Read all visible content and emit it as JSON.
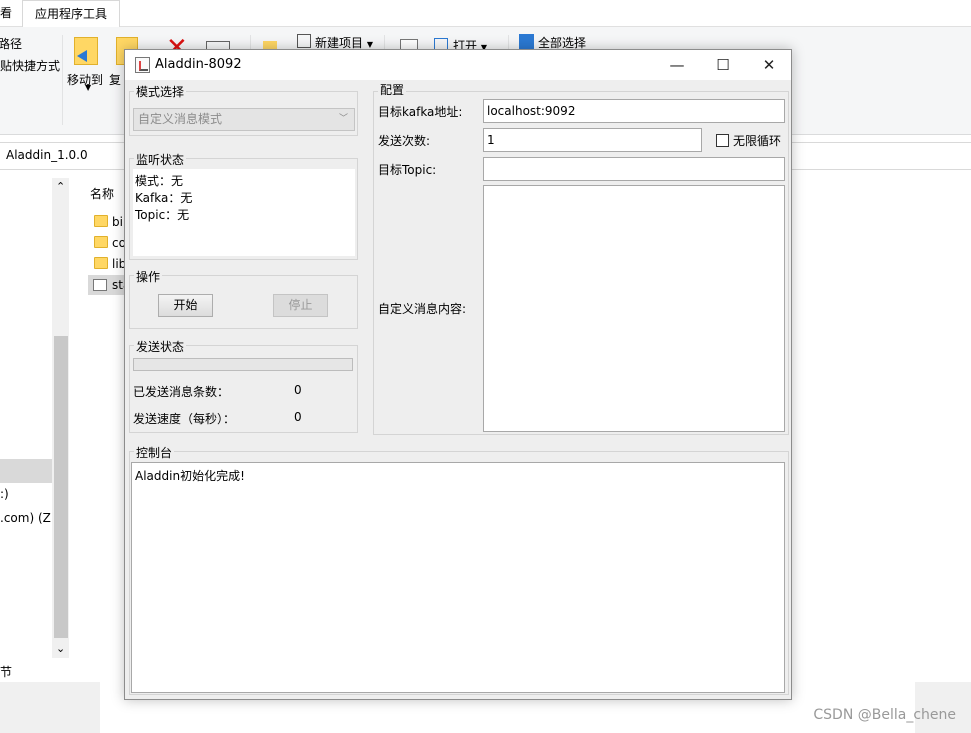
{
  "explorer": {
    "tab_fragment": "看",
    "active_tab": "应用程序工具",
    "ribbon": {
      "path_label": "复制路径",
      "shortcut_label": "粘贴快捷方式",
      "move_to": "移动到",
      "copy_to": "复",
      "new_item": "新建项目",
      "open": "打开",
      "select_all": "全部选择"
    },
    "address": "Aladdin_1.0.0",
    "column_name": "名称",
    "files": [
      "bin",
      "conf",
      "lib",
      "start"
    ],
    "nav_items": [
      ":)",
      ".com) (Z:)"
    ],
    "status": "节",
    "watermark": "CSDN @Bella_chene"
  },
  "window": {
    "title": "Aladdin-8092",
    "controls": {
      "minimize": "—",
      "maximize": "☐",
      "close": "✕"
    },
    "mode": {
      "title": "模式选择",
      "selected": "自定义消息模式"
    },
    "monitor": {
      "title": "监听状态",
      "lines": [
        "模式：无",
        "Kafka：无",
        "Topic：无"
      ]
    },
    "ops": {
      "title": "操作",
      "start": "开始",
      "stop": "停止"
    },
    "send_status": {
      "title": "发送状态",
      "progress": 0,
      "sent_label": "已发送消息条数：",
      "sent_value": "0",
      "speed_label": "发送速度（每秒）：",
      "speed_value": "0"
    },
    "config": {
      "title": "配置",
      "kafka_label": "目标kafka地址:",
      "kafka_value": "localhost:9092",
      "count_label": "发送次数:",
      "count_value": "1",
      "loop_label": "无限循环",
      "topic_label": "目标Topic:",
      "topic_value": "",
      "content_label": "自定义消息内容:",
      "content_value": ""
    },
    "console": {
      "title": "控制台",
      "text": "Aladdin初始化完成!"
    }
  }
}
